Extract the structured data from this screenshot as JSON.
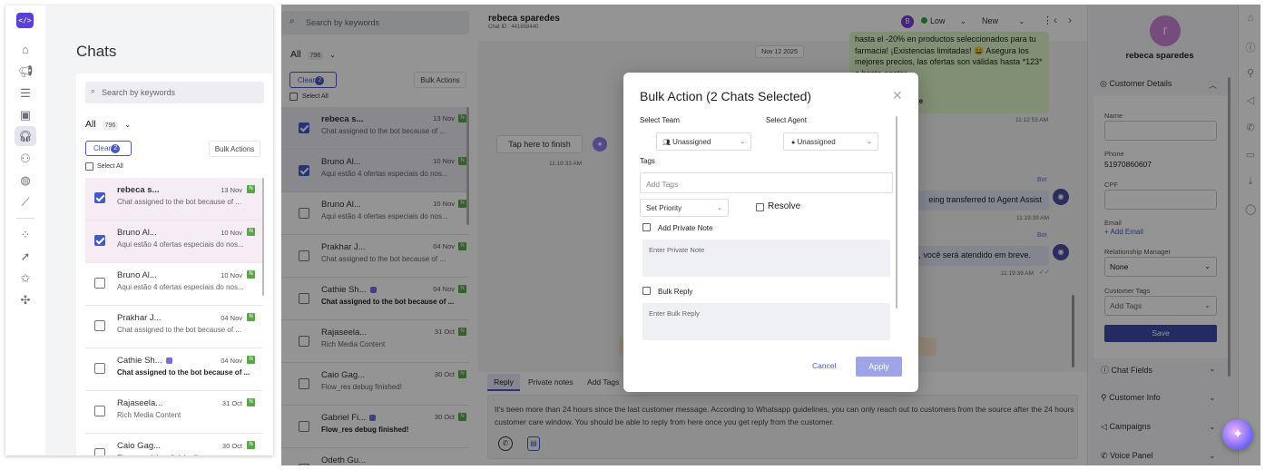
{
  "left": {
    "title": "Chats",
    "search_placeholder": "Search by keywords",
    "filter_label": "All",
    "count": "796",
    "clear_label": "Clear",
    "clear_count": "2",
    "bulk_actions": "Bulk Actions",
    "select_all": "Select All",
    "rows": [
      {
        "name": "rebeca s...",
        "date": "13 Nov",
        "badge": "N",
        "msg": "Chat assigned to the bot because of ...",
        "checked": true,
        "bold": false,
        "dot": false
      },
      {
        "name": "Bruno Al...",
        "date": "10 Nov",
        "badge": "N",
        "msg": "Aqui estão 4 ofertas especiais do nos...",
        "checked": true,
        "bold": false,
        "dot": false
      },
      {
        "name": "Bruno Al...",
        "date": "10 Nov",
        "badge": "N",
        "msg": "Aqui estão 4 ofertas especiais do nos...",
        "checked": false,
        "bold": false,
        "dot": false
      },
      {
        "name": "Prakhar J...",
        "date": "04 Nov",
        "badge": "N",
        "msg": "Chat assigned to the bot because of ...",
        "checked": false,
        "bold": false,
        "dot": false
      },
      {
        "name": "Cathie Sh...",
        "date": "04 Nov",
        "badge": "N",
        "msg": "Chat assigned to the bot because of ...",
        "checked": false,
        "bold": true,
        "dot": true
      },
      {
        "name": "Rajaseela...",
        "date": "31 Oct",
        "badge": "N",
        "msg": "Rich Media Content",
        "checked": false,
        "bold": false,
        "dot": false
      },
      {
        "name": "Caio Gag...",
        "date": "30 Oct",
        "badge": "N",
        "msg": "Flow_res debug finished!",
        "checked": false,
        "bold": false,
        "dot": false
      }
    ]
  },
  "main": {
    "search_placeholder": "Search by keywords",
    "filter_label": "All",
    "count": "796",
    "clear_label": "Clear",
    "clear_count": "2",
    "bulk_actions": "Bulk Actions",
    "select_all": "Select All",
    "rows": [
      {
        "name": "rebeca s...",
        "date": "13 Nov",
        "badge": "N",
        "msg": "Chat assigned to the bot because of ...",
        "checked": true,
        "bold": false,
        "dot": false
      },
      {
        "name": "Bruno Al...",
        "date": "10 Nov",
        "badge": "N",
        "msg": "Aqui estão 4 ofertas especiais do nos...",
        "checked": true,
        "bold": false,
        "dot": false
      },
      {
        "name": "Bruno Al...",
        "date": "10 Nov",
        "badge": "N",
        "msg": "Aqui estão 4 ofertas especiais do nos...",
        "checked": false,
        "bold": false,
        "dot": false
      },
      {
        "name": "Prakhar J...",
        "date": "04 Nov",
        "badge": "N",
        "msg": "Chat assigned to the bot because of ...",
        "checked": false,
        "bold": false,
        "dot": false
      },
      {
        "name": "Cathie Sh...",
        "date": "04 Nov",
        "badge": "N",
        "msg": "Chat assigned to the bot because of ...",
        "checked": false,
        "bold": true,
        "dot": true
      },
      {
        "name": "Rajaseela...",
        "date": "31 Oct",
        "badge": "N",
        "msg": "Rich Media Content",
        "checked": false,
        "bold": false,
        "dot": false
      },
      {
        "name": "Caio Gag...",
        "date": "30 Oct",
        "badge": "N",
        "msg": "Flow_res debug finished!",
        "checked": false,
        "bold": false,
        "dot": false
      },
      {
        "name": "Gabriel Fi...",
        "date": "30 Oct",
        "badge": "N",
        "msg": "Flow_res debug finished!",
        "checked": false,
        "bold": true,
        "dot": true
      },
      {
        "name": "Odeth Gu...",
        "date": "",
        "badge": "",
        "msg": "",
        "checked": false,
        "bold": false,
        "dot": false
      }
    ],
    "chat": {
      "contact_name": "rebeca sparedes",
      "chat_id": "Chat ID : 441658440",
      "avatar_letter": "B",
      "priority": "Low",
      "status": "New",
      "date_chip": "Nov 12 2025",
      "green_msg": "hasta el -20% en productos seleccionados para tu farmacia! ¡Existencias limitadas! 😀 Asegura los mejores precios, las ofertas son válidas hasta *123* o hasta agotar",
      "green_tail": "te",
      "green_time": "11:12:53 AM",
      "tap_btn": "Tap here to finish",
      "tap_time": "11:19:33 AM",
      "bot_label": "Bot",
      "transfer_msg": "eing transferred to Agent Assist",
      "transfer_time": "11:19:39 AM",
      "bot_label2": "Bot",
      "atendido_msg": ", você será atendido em breve.",
      "atendido_time": "11:19:39 AM",
      "tab_reply": "Reply",
      "tab_private": "Private notes",
      "tab_tags": "Add Tags",
      "notice": "It's been more than 24 hours since the last customer message. According to Whatsapp guidelines, you can only reach out to customers from the source after the 24 hours customer care window. You should be able to reply from here once you get reply from the customer."
    },
    "right": {
      "avatar_letter": "r",
      "name": "rebeca sparedes",
      "details_title": "Customer Details",
      "name_label": "Name",
      "phone_label": "Phone",
      "phone_value": "51970860607",
      "cpf_label": "CPF",
      "email_label": "Email",
      "add_email": "+ Add Email",
      "rm_label": "Relationship Manager",
      "rm_value": "None",
      "tags_label": "Customer Tags",
      "tags_value": "Add Tags",
      "save": "Save",
      "chat_fields": "Chat Fields",
      "customer_info": "Customer Info",
      "campaigns": "Campaigns",
      "voice_panel": "Voice Panel"
    }
  },
  "modal": {
    "title": "Bulk Action (2 Chats Selected)",
    "select_team": "Select Team",
    "select_agent": "Select Agent",
    "team_value": "Unassigned",
    "agent_value": "Unassigned",
    "tags_label": "Tags",
    "tags_placeholder": "Add Tags",
    "priority_value": "Set Priority",
    "resolve": "Resolve",
    "private_note_label": "Add Private Note",
    "private_note_placeholder": "Enter Private Note",
    "bulk_reply_label": "Bulk Reply",
    "bulk_reply_placeholder": "Enter Bulk Reply",
    "cancel": "Cancel",
    "apply": "Apply"
  },
  "colors": {
    "accent": "#4659c9",
    "apply": "#9ea4e8",
    "save": "#3e4aa8",
    "badge": "#5aa54a"
  }
}
